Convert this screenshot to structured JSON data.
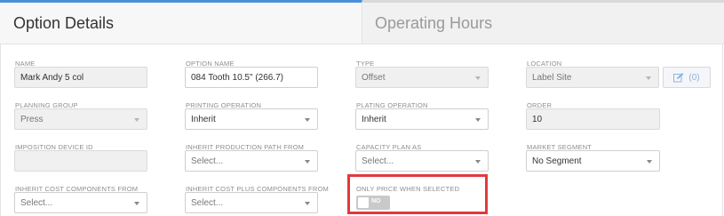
{
  "tabs": {
    "active": "Option Details",
    "inactive": "Operating Hours"
  },
  "row1": {
    "name": {
      "label": "NAME",
      "value": "Mark Andy 5 col"
    },
    "option_name": {
      "label": "OPTION NAME",
      "value": "084 Tooth 10.5\" (266.7)"
    },
    "type": {
      "label": "TYPE",
      "value": "Offset"
    },
    "location": {
      "label": "LOCATION",
      "value": "Label Site"
    },
    "edit_count": "(0)"
  },
  "row2": {
    "planning_group": {
      "label": "PLANNING GROUP",
      "value": "Press"
    },
    "printing_operation": {
      "label": "PRINTING OPERATION",
      "value": "Inherit"
    },
    "plating_operation": {
      "label": "PLATING OPERATION",
      "value": "Inherit"
    },
    "order": {
      "label": "ORDER",
      "value": "10"
    }
  },
  "row3": {
    "imposition_device_id": {
      "label": "IMPOSITION DEVICE ID",
      "value": ""
    },
    "inherit_production_path": {
      "label": "INHERIT PRODUCTION PATH FROM",
      "placeholder": "Select..."
    },
    "capacity_plan_as": {
      "label": "CAPACITY PLAN AS",
      "placeholder": "Select..."
    },
    "market_segment": {
      "label": "MARKET SEGMENT",
      "value": "No Segment"
    }
  },
  "row4": {
    "inherit_cost_components": {
      "label": "INHERIT COST COMPONENTS FROM",
      "placeholder": "Select..."
    },
    "inherit_cost_plus_components": {
      "label": "INHERIT COST PLUS COMPONENTS FROM",
      "placeholder": "Select..."
    },
    "only_price_when_selected": {
      "label": "ONLY PRICE WHEN SELECTED",
      "toggle_label": "NO",
      "value": false
    }
  },
  "colors": {
    "accent": "#4a90d9",
    "highlight": "#e03a3e"
  }
}
